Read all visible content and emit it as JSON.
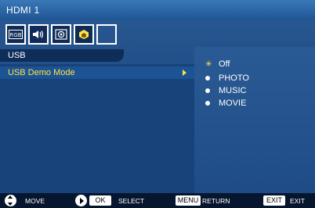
{
  "window": {
    "title": "HDMI 1"
  },
  "icons": [
    {
      "name": "rgb-picture-icon",
      "label": "RGB"
    },
    {
      "name": "speaker-icon"
    },
    {
      "name": "display-setup-icon"
    },
    {
      "name": "option-icon"
    },
    {
      "name": "empty"
    }
  ],
  "menu": {
    "section": "USB",
    "item_label": "USB Demo Mode"
  },
  "options": [
    {
      "label": "Off",
      "selected": true
    },
    {
      "label": "PHOTO",
      "selected": false
    },
    {
      "label": "MUSIC",
      "selected": false
    },
    {
      "label": "MOVIE",
      "selected": false
    }
  ],
  "footer": {
    "move": "MOVE",
    "ok_key": "OK",
    "select": "SELECT",
    "menu_key": "MENU",
    "return": "RETURN",
    "exit_key": "EXIT",
    "exit": "EXIT"
  },
  "colors": {
    "accent": "#ffe44a",
    "panel": "#17427a",
    "title_bar": "#3a78b8"
  }
}
